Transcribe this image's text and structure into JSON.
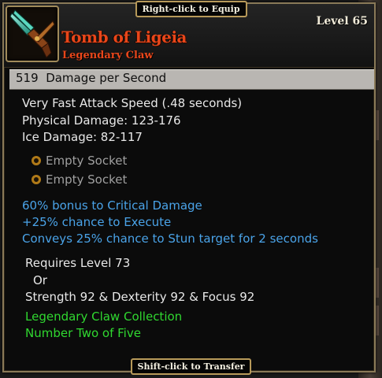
{
  "hints": {
    "equip": "Right-click to Equip",
    "transfer": "Shift-click to Transfer"
  },
  "item": {
    "name": "Tomb of Ligeia",
    "type": "Legendary Claw",
    "level_label": "Level 65",
    "icon": "claw-weapon-icon",
    "name_color": "#e8461a"
  },
  "dps": {
    "value": "519",
    "label": "Damage per Second"
  },
  "stats": [
    "Very Fast Attack Speed (.48 seconds)",
    "Physical Damage: 123-176",
    "Ice Damage: 82-117"
  ],
  "sockets": [
    "Empty Socket",
    "Empty Socket"
  ],
  "modifiers": [
    "60% bonus to Critical Damage",
    "+25% chance to Execute",
    "Conveys 25% chance to Stun target for 2 seconds"
  ],
  "requirements": {
    "level": "Requires Level 73",
    "or": "Or",
    "attributes": "Strength 92 & Dexterity 92 & Focus 92"
  },
  "collection": {
    "name": "Legendary Claw Collection",
    "position": "Number Two of Five"
  },
  "colors": {
    "legendary": "#e8461a",
    "modifier": "#4aa3e8",
    "collection": "#30d830",
    "border": "#b89a5a"
  }
}
